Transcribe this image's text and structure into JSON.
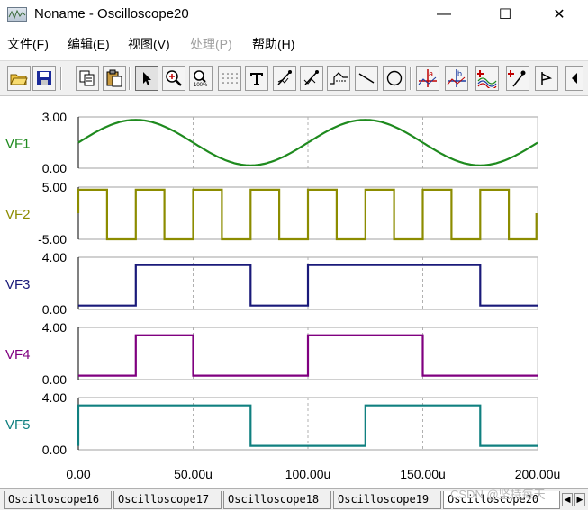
{
  "window": {
    "title": "Noname - Oscilloscope20",
    "minimize_glyph": "—",
    "maximize_glyph": "☐",
    "close_glyph": "✕"
  },
  "menu": [
    {
      "label": "文件(F)",
      "enabled": true
    },
    {
      "label": "编辑(E)",
      "enabled": true
    },
    {
      "label": "视图(V)",
      "enabled": true
    },
    {
      "label": "处理(P)",
      "enabled": false
    },
    {
      "label": "帮助(H)",
      "enabled": true
    }
  ],
  "toolbar": {
    "buttons": [
      {
        "icon": "open-folder-icon"
      },
      {
        "icon": "save-icon"
      },
      {
        "icon": "copy-icon"
      },
      {
        "icon": "paste-icon"
      },
      {
        "icon": "pointer-icon"
      },
      {
        "icon": "zoom-in-icon"
      },
      {
        "icon": "zoom-100-icon"
      },
      {
        "icon": "grid-icon"
      },
      {
        "icon": "text-icon"
      },
      {
        "icon": "probe-icon"
      },
      {
        "icon": "probe-alt-icon"
      },
      {
        "icon": "step-wave-icon"
      },
      {
        "icon": "line-icon"
      },
      {
        "icon": "circle-icon"
      },
      {
        "icon": "cursor-a-icon"
      },
      {
        "icon": "cursor-b-icon"
      },
      {
        "icon": "add-trace-icon"
      },
      {
        "icon": "marker-icon"
      },
      {
        "icon": "flag-icon"
      },
      {
        "icon": "scroll-left-icon"
      }
    ]
  },
  "chart_data": {
    "type": "line",
    "x_unit": "u",
    "xlim": [
      0,
      200
    ],
    "x_ticks": [
      "0.00",
      "50.00u",
      "100.00u",
      "150.00u",
      "200.00u"
    ],
    "x_tick_values": [
      0,
      50,
      100,
      150,
      200
    ],
    "channels": [
      {
        "name": "VF1",
        "color": "#1e8a1e",
        "kind": "sine",
        "ylim": [
          0,
          3
        ],
        "y_top_label": "3.00",
        "y_bottom_label": "0.00",
        "sine": {
          "offset": 1.5,
          "amplitude": 1.33,
          "period": 100,
          "peak_at": 25
        }
      },
      {
        "name": "VF2",
        "color": "#8c8c00",
        "kind": "square",
        "ylim": [
          -5,
          5
        ],
        "y_top_label": "5.00",
        "y_bottom_label": "-5.00",
        "high": 4.5,
        "low": -5.0,
        "edges": [
          [
            0,
            0
          ],
          [
            0,
            4.5
          ],
          [
            12.5,
            4.5
          ],
          [
            12.5,
            -5
          ],
          [
            25,
            -5
          ],
          [
            25,
            4.5
          ],
          [
            37.5,
            4.5
          ],
          [
            37.5,
            -5
          ],
          [
            50,
            -5
          ],
          [
            50,
            4.5
          ],
          [
            62.5,
            4.5
          ],
          [
            62.5,
            -5
          ],
          [
            75,
            -5
          ],
          [
            75,
            4.5
          ],
          [
            87.5,
            4.5
          ],
          [
            87.5,
            -5
          ],
          [
            100,
            -5
          ],
          [
            100,
            4.5
          ],
          [
            112.5,
            4.5
          ],
          [
            112.5,
            -5
          ],
          [
            125,
            -5
          ],
          [
            125,
            4.5
          ],
          [
            137.5,
            4.5
          ],
          [
            137.5,
            -5
          ],
          [
            150,
            -5
          ],
          [
            150,
            4.5
          ],
          [
            162.5,
            4.5
          ],
          [
            162.5,
            -5
          ],
          [
            175,
            -5
          ],
          [
            175,
            4.5
          ],
          [
            187.5,
            4.5
          ],
          [
            187.5,
            -5
          ],
          [
            199.5,
            -5
          ],
          [
            199.5,
            0
          ]
        ]
      },
      {
        "name": "VF3",
        "color": "#1a1a7a",
        "kind": "step",
        "ylim": [
          0,
          4
        ],
        "y_top_label": "4.00",
        "y_bottom_label": "0.00",
        "edges": [
          [
            0,
            0.3
          ],
          [
            25,
            0.3
          ],
          [
            25,
            3.4
          ],
          [
            75,
            3.4
          ],
          [
            75,
            0.3
          ],
          [
            100,
            0.3
          ],
          [
            100,
            3.4
          ],
          [
            175,
            3.4
          ],
          [
            175,
            0.3
          ],
          [
            200,
            0.3
          ]
        ]
      },
      {
        "name": "VF4",
        "color": "#800080",
        "kind": "step",
        "ylim": [
          0,
          4
        ],
        "y_top_label": "4.00",
        "y_bottom_label": "0.00",
        "edges": [
          [
            0,
            0.3
          ],
          [
            25,
            0.3
          ],
          [
            25,
            3.4
          ],
          [
            50,
            3.4
          ],
          [
            50,
            0.3
          ],
          [
            100,
            0.3
          ],
          [
            100,
            3.4
          ],
          [
            150,
            3.4
          ],
          [
            150,
            0.3
          ],
          [
            200,
            0.3
          ]
        ]
      },
      {
        "name": "VF5",
        "color": "#108080",
        "kind": "step",
        "ylim": [
          0,
          4
        ],
        "y_top_label": "4.00",
        "y_bottom_label": "0.00",
        "edges": [
          [
            0,
            0.3
          ],
          [
            0,
            3.4
          ],
          [
            75,
            3.4
          ],
          [
            75,
            0.3
          ],
          [
            125,
            0.3
          ],
          [
            125,
            3.4
          ],
          [
            175,
            3.4
          ],
          [
            175,
            0.3
          ],
          [
            200,
            0.3
          ]
        ]
      }
    ]
  },
  "tabs": [
    {
      "label": "Oscilloscope16",
      "active": false
    },
    {
      "label": "Oscilloscope17",
      "active": false
    },
    {
      "label": "Oscilloscope18",
      "active": false
    },
    {
      "label": "Oscilloscope19",
      "active": false
    },
    {
      "label": "Oscilloscope20",
      "active": true
    }
  ],
  "tab_scroll": {
    "left": "◀",
    "right": "▶"
  },
  "watermark": "CSDN @坚持每天"
}
